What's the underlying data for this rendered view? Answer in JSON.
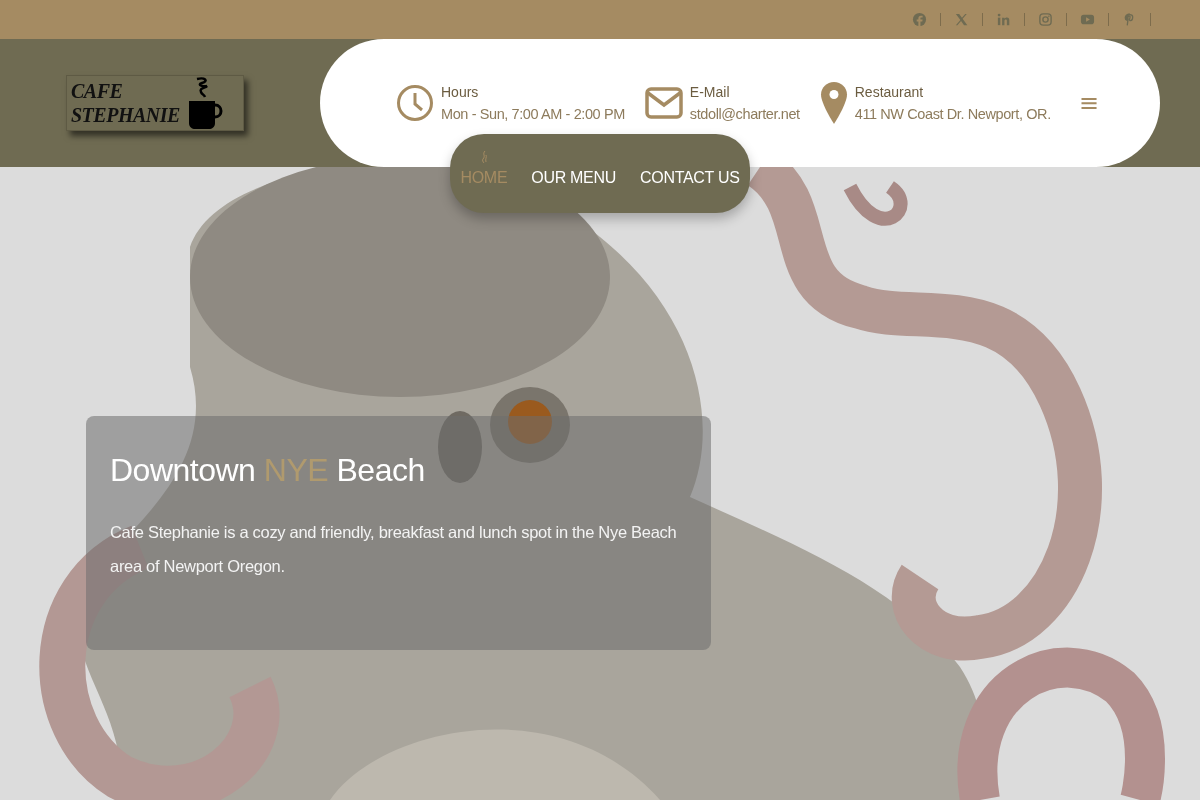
{
  "logo": {
    "lines": [
      "CAFE",
      "STEPHANIE"
    ]
  },
  "contacts": [
    {
      "kind": "clock",
      "label": "Hours",
      "value": "Mon - Sun, 7:00 AM - 2:00 PM"
    },
    {
      "kind": "mail",
      "label": "E-Mail",
      "value": "stdoll@charter.net"
    },
    {
      "kind": "pin",
      "label": "Restaurant",
      "value": "411 NW Coast Dr. Newport, OR."
    }
  ],
  "menu_toggle": "≡",
  "nav": [
    {
      "label": "HOME",
      "selected": true
    },
    {
      "label": "OUR MENU",
      "selected": false
    },
    {
      "label": "CONTACT US",
      "selected": false
    }
  ],
  "hero": {
    "title": [
      {
        "text": "Downtown ",
        "accent": false
      },
      {
        "text": "NYE",
        "accent": true
      },
      {
        "text": " Beach",
        "accent": false
      }
    ],
    "text": "Cafe Stephanie is a cozy and friendly, breakfast and lunch spot in the Nye Beach area of Newport Oregon."
  }
}
